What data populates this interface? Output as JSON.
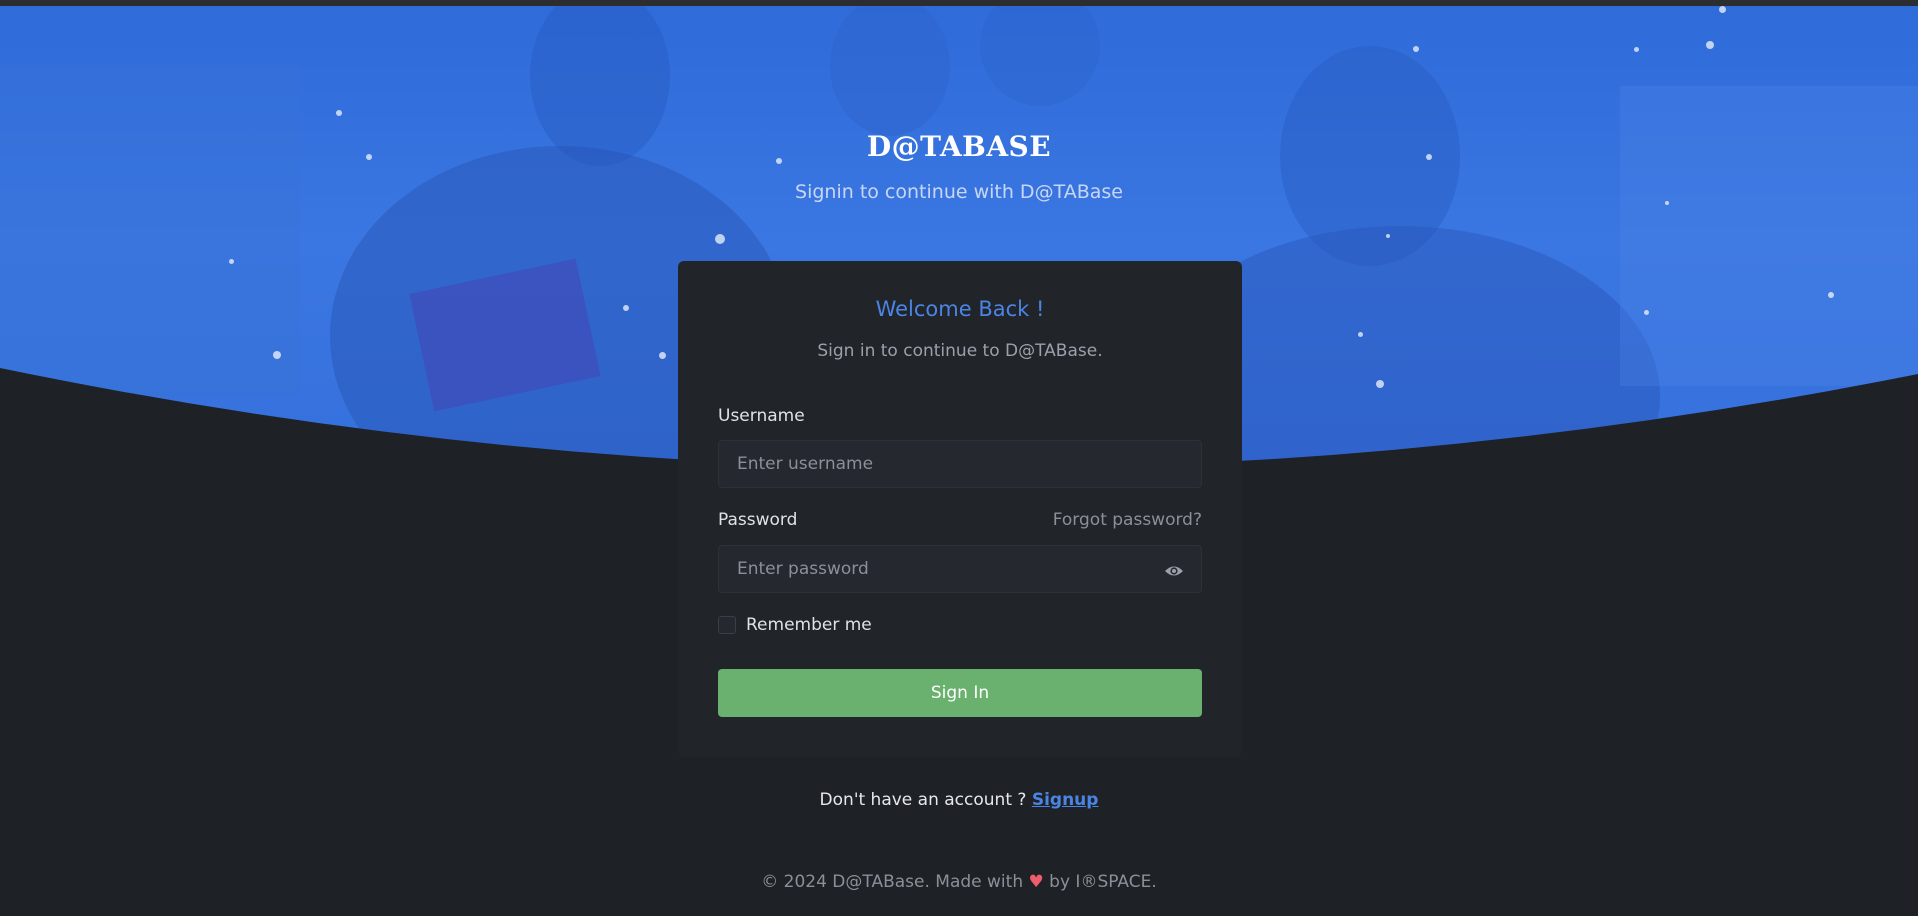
{
  "brand": {
    "name": "D@TABASE",
    "tagline": "Signin to continue with D@TABase"
  },
  "card": {
    "title": "Welcome Back !",
    "subtitle": "Sign in to continue to D@TABase.",
    "username": {
      "label": "Username",
      "placeholder": "Enter username",
      "value": ""
    },
    "password": {
      "label": "Password",
      "placeholder": "Enter password",
      "value": "",
      "forgot_label": "Forgot password?",
      "toggle_icon": "eye-icon"
    },
    "remember": {
      "label": "Remember me",
      "checked": false
    },
    "submit_label": "Sign In"
  },
  "signup": {
    "prompt": "Don't have an account ?",
    "link_label": "Signup"
  },
  "footer": {
    "before": "© 2024 D@TABase. Made with",
    "heart": "♥",
    "after": "by I®SPACE."
  },
  "colors": {
    "hero": "#3a76e0",
    "page_bg": "#1e2126",
    "card_bg": "#212429",
    "accent": "#4a85e6",
    "button": "#6ab06e",
    "heart": "#ef5c6b"
  }
}
